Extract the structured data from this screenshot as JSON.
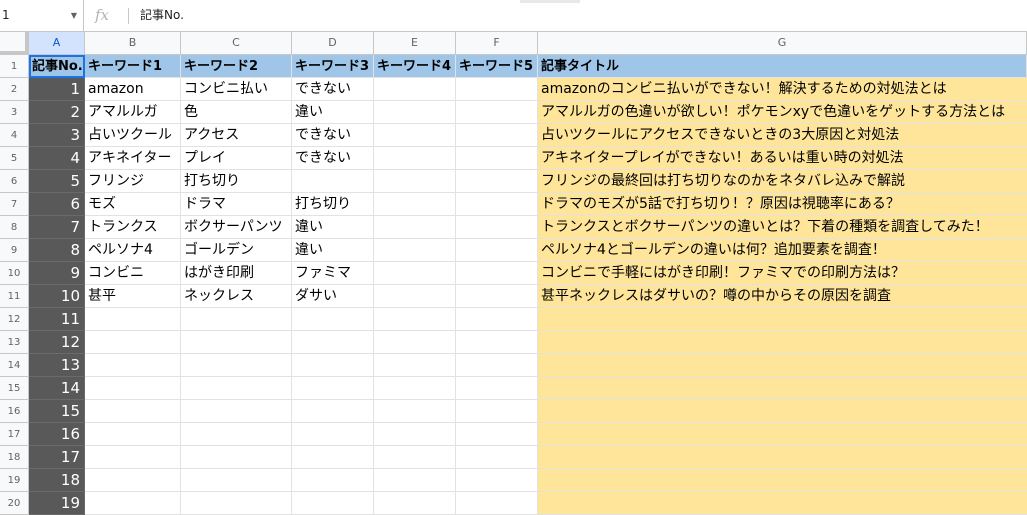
{
  "formula_bar": {
    "name_box": "1",
    "fx_label": "fx",
    "content": "記事No."
  },
  "columns": [
    "A",
    "B",
    "C",
    "D",
    "E",
    "F",
    "G"
  ],
  "row_numbers": [
    "1",
    "2",
    "3",
    "4",
    "5",
    "6",
    "7",
    "8",
    "9",
    "10",
    "11",
    "12",
    "13",
    "14",
    "15",
    "16",
    "17",
    "18",
    "19",
    "20"
  ],
  "header_row": [
    "記事No.",
    "キーワード1",
    "キーワード2",
    "キーワード3",
    "キーワード4",
    "キーワード5",
    "記事タイトル"
  ],
  "rows": [
    [
      "1",
      "amazon",
      "コンビニ払い",
      "できない",
      "",
      "",
      "amazonのコンビニ払いができない！解決するための対処法とは"
    ],
    [
      "2",
      "アマルルガ",
      "色",
      "違い",
      "",
      "",
      "アマルルガの色違いが欲しい！ポケモンxyで色違いをゲットする方法とは"
    ],
    [
      "3",
      "占いツクール",
      "アクセス",
      "できない",
      "",
      "",
      "占いツクールにアクセスできないときの3大原因と対処法"
    ],
    [
      "4",
      "アキネイター",
      "プレイ",
      "できない",
      "",
      "",
      "アキネイタープレイができない！あるいは重い時の対処法"
    ],
    [
      "5",
      "フリンジ",
      "打ち切り",
      "",
      "",
      "",
      "フリンジの最終回は打ち切りなのかをネタバレ込みで解説"
    ],
    [
      "6",
      "モズ",
      "ドラマ",
      "打ち切り",
      "",
      "",
      "ドラマのモズが5話で打ち切り！？原因は視聴率にある？"
    ],
    [
      "7",
      "トランクス",
      "ボクサーパンツ",
      "違い",
      "",
      "",
      "トランクスとボクサーパンツの違いとは？下着の種類を調査してみた！"
    ],
    [
      "8",
      "ペルソナ4",
      "ゴールデン",
      "違い",
      "",
      "",
      "ペルソナ4とゴールデンの違いは何？追加要素を調査！"
    ],
    [
      "9",
      "コンビニ",
      "はがき印刷",
      "ファミマ",
      "",
      "",
      "コンビニで手軽にはがき印刷！ファミマでの印刷方法は？"
    ],
    [
      "10",
      "甚平",
      "ネックレス",
      "ダサい",
      "",
      "",
      "甚平ネックレスはダサいの？噂の中からその原因を調査"
    ],
    [
      "11",
      "",
      "",
      "",
      "",
      "",
      ""
    ],
    [
      "12",
      "",
      "",
      "",
      "",
      "",
      ""
    ],
    [
      "13",
      "",
      "",
      "",
      "",
      "",
      ""
    ],
    [
      "14",
      "",
      "",
      "",
      "",
      "",
      ""
    ],
    [
      "15",
      "",
      "",
      "",
      "",
      "",
      ""
    ],
    [
      "16",
      "",
      "",
      "",
      "",
      "",
      ""
    ],
    [
      "17",
      "",
      "",
      "",
      "",
      "",
      ""
    ],
    [
      "18",
      "",
      "",
      "",
      "",
      "",
      ""
    ],
    [
      "19",
      "",
      "",
      "",
      "",
      "",
      ""
    ]
  ],
  "colors": {
    "header_fill": "#9fc5e8",
    "column_a_fill": "#595959",
    "column_g_fill": "#ffe599",
    "selection": "#1a73e8"
  }
}
